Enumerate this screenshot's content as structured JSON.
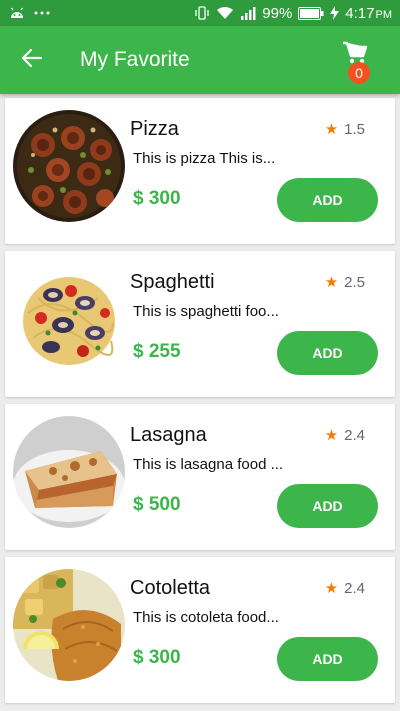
{
  "status_bar": {
    "battery": "99%",
    "time": "4:17",
    "ampm": "PM",
    "icons": [
      "android-icon",
      "more-dots-icon",
      "vibrate-icon",
      "wifi-icon",
      "signal-icon",
      "battery-icon",
      "charging-icon"
    ]
  },
  "app_bar": {
    "title": "My Favorite",
    "cart_count": "0",
    "back_icon": "arrow-back-icon",
    "cart_icon": "cart-icon"
  },
  "colors": {
    "primary": "#3cb54a",
    "status_bar": "#2e9b3c",
    "badge": "#f4511e",
    "star": "#f57c00"
  },
  "items": [
    {
      "name": "Pizza",
      "rating": "1.5",
      "description": "This is pizza This is...",
      "price": "$ 300",
      "button": "ADD"
    },
    {
      "name": "Spaghetti",
      "rating": "2.5",
      "description": "This is spaghetti foo...",
      "price": "$ 255",
      "button": "ADD"
    },
    {
      "name": "Lasagna",
      "rating": "2.4",
      "description": "This is lasagna food ...",
      "price": "$ 500",
      "button": "ADD"
    },
    {
      "name": "Cotoletta",
      "rating": "2.4",
      "description": "This is cotoleta food...",
      "price": "$ 300",
      "button": "ADD"
    }
  ]
}
